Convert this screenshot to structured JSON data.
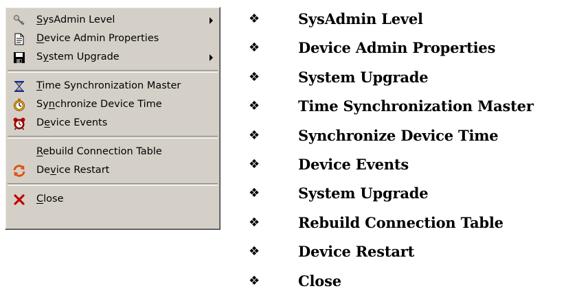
{
  "menu": {
    "groups": [
      {
        "items": [
          {
            "pre": "",
            "key": "S",
            "post": "ysAdmin Level",
            "icon": "keys-icon",
            "has_submenu": true
          },
          {
            "pre": "",
            "key": "D",
            "post": "evice Admin Properties",
            "icon": "document-icon",
            "has_submenu": false
          },
          {
            "pre": "S",
            "key": "y",
            "post": "stem Upgrade",
            "icon": "floppy-disk-icon",
            "has_submenu": true
          }
        ]
      },
      {
        "items": [
          {
            "pre": "",
            "key": "T",
            "post": "ime Synchronization Master",
            "icon": "hourglass-icon",
            "has_submenu": false
          },
          {
            "pre": "Sy",
            "key": "n",
            "post": "chronize Device Time",
            "icon": "stopwatch-icon",
            "has_submenu": false
          },
          {
            "pre": "D",
            "key": "e",
            "post": "vice Events",
            "icon": "alarm-clock-icon",
            "has_submenu": false
          }
        ]
      },
      {
        "items": [
          {
            "pre": "",
            "key": "R",
            "post": "ebuild Connection Table",
            "icon": "",
            "has_submenu": false
          },
          {
            "pre": "De",
            "key": "v",
            "post": "ice Restart",
            "icon": "restart-arrows-icon",
            "has_submenu": false
          }
        ]
      },
      {
        "items": [
          {
            "pre": "",
            "key": "C",
            "post": "lose",
            "icon": "close-x-icon",
            "has_submenu": false
          }
        ]
      }
    ]
  },
  "bullets": {
    "glyph": "❖",
    "items": [
      "SysAdmin Level",
      "Device Admin Properties",
      "System Upgrade",
      "Time Synchronization Master",
      "Synchronize Device Time",
      "Device Events",
      "System Upgrade",
      "Rebuild Connection Table",
      "Device Restart",
      "Close"
    ]
  },
  "colors": {
    "menu_face": "#d4d0c8",
    "close_icon": "#c00000",
    "restart_icon": "#e05010",
    "hourglass_icon": "#1a2a8a"
  }
}
